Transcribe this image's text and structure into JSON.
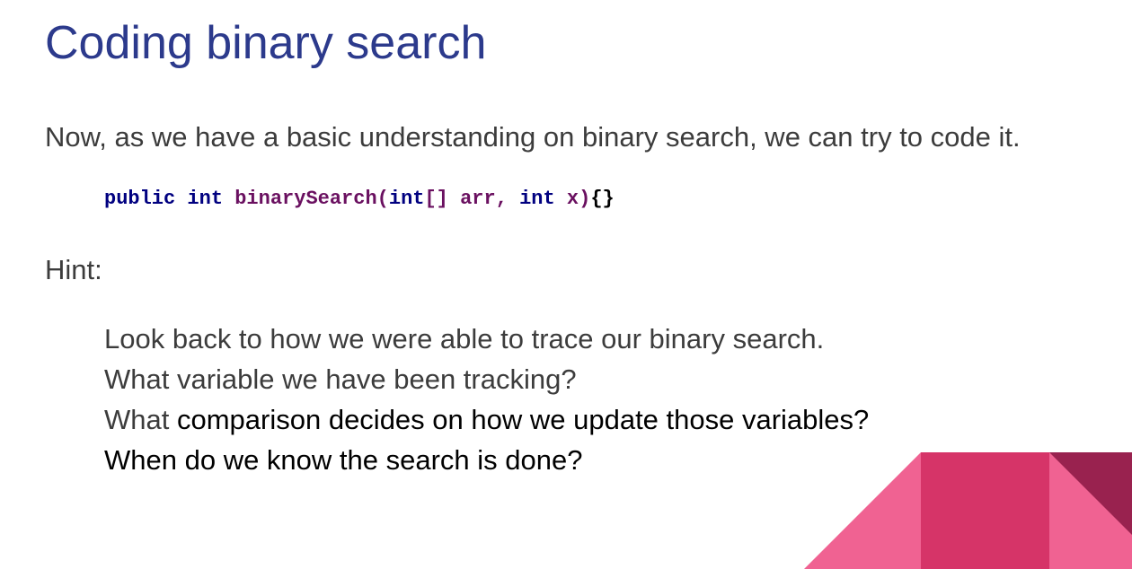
{
  "slide": {
    "title": "Coding binary search",
    "intro": "Now, as we have a basic understanding on binary search, we can try to code it.",
    "code": {
      "kw_public": "public",
      "kw_int1": "int",
      "method_name": "binarySearch",
      "paren_open": "(",
      "kw_int2": "int",
      "brackets": "[]",
      "param_arr": "arr",
      "comma": ",",
      "kw_int3": "int",
      "param_x": "x",
      "paren_close": ")",
      "braces": "{}"
    },
    "hint_label": "Hint:",
    "hints": [
      {
        "text": "Look back to how we were able to trace our binary search."
      },
      {
        "text": "What variable we have been tracking?"
      },
      {
        "lead": "What",
        "rest": " comparison decides on how we update those variables?"
      },
      {
        "text": "When do we know the search is done?"
      }
    ]
  },
  "colors": {
    "title": "#2c3a8c",
    "body_text": "#3c3c3c",
    "code_keyword": "#000080",
    "code_identifier": "#6a1060",
    "deco_light_pink": "#f06292",
    "deco_mid_pink": "#d63468",
    "deco_dark_pink": "#99224f"
  }
}
